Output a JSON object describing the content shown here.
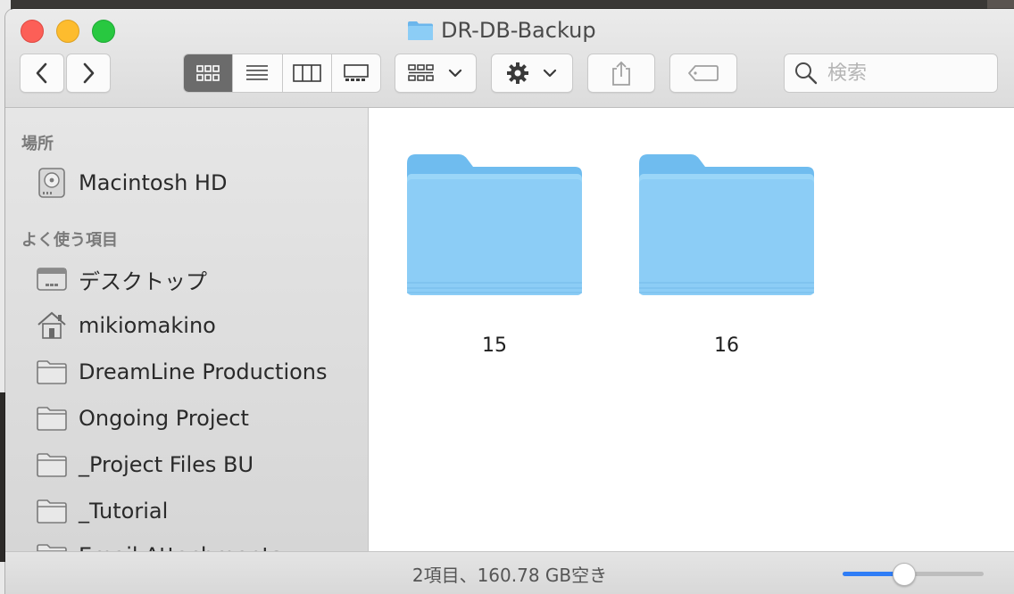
{
  "window": {
    "title": "DR-DB-Backup"
  },
  "toolbar": {
    "search_placeholder": "検索"
  },
  "sidebar": {
    "sections": [
      {
        "title": "場所"
      },
      {
        "title": "よく使う項目"
      }
    ],
    "items": [
      {
        "label": "Macintosh HD",
        "icon": "hard-drive-icon"
      },
      {
        "label": "デスクトップ",
        "icon": "desktop-icon"
      },
      {
        "label": "mikiomakino",
        "icon": "home-icon"
      },
      {
        "label": "DreamLine Productions",
        "icon": "folder-icon"
      },
      {
        "label": "Ongoing Project",
        "icon": "folder-icon"
      },
      {
        "label": "_Project Files BU",
        "icon": "folder-icon"
      },
      {
        "label": "_Tutorial",
        "icon": "folder-icon"
      },
      {
        "label": "Email Attachments",
        "icon": "folder-icon"
      }
    ]
  },
  "content": {
    "folders": [
      {
        "name": "15"
      },
      {
        "name": "16"
      }
    ]
  },
  "status": {
    "text": "2項目、160.78 GB空き",
    "icon_size_fraction": 0.43
  },
  "colors": {
    "folder_blue": "#8ccdf6",
    "accent": "#2f7df6"
  }
}
